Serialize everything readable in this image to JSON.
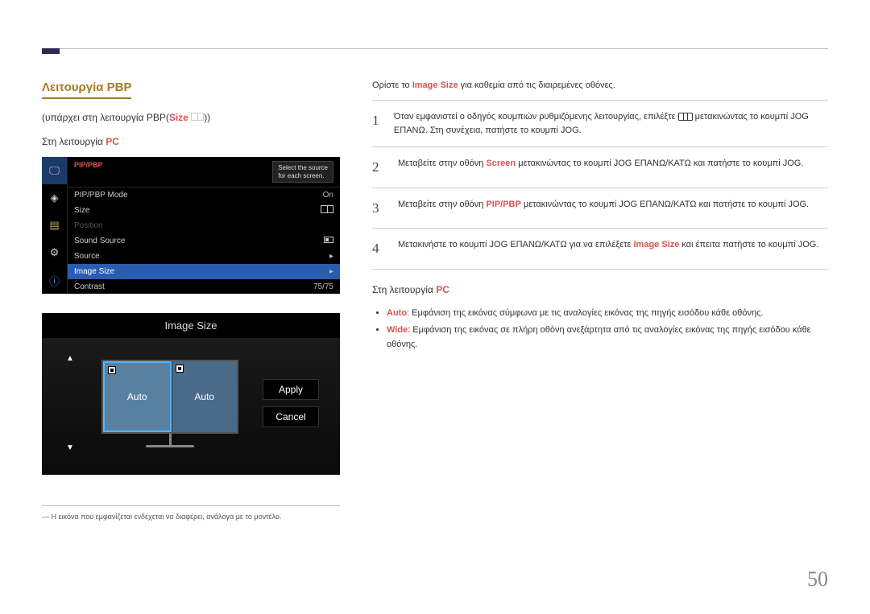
{
  "title": "Λειτουργία PBP",
  "subtitle_prefix": "(υπάρχει στη λειτουργία PBP(",
  "subtitle_accent": "Size",
  "subtitle_suffix": " ",
  "subtitle_close": "))",
  "mode_prefix": "Στη λειτουργία ",
  "mode_accent": "PC",
  "osd": {
    "head": "PIP/PBP",
    "tooltip_line1": "Select the source",
    "tooltip_line2": "for each screen.",
    "rows": [
      {
        "label": "PIP/PBP Mode",
        "value": "On",
        "disabled": false,
        "selected": false,
        "icon": null
      },
      {
        "label": "Size",
        "value": "",
        "disabled": false,
        "selected": false,
        "icon": "split"
      },
      {
        "label": "Position",
        "value": "",
        "disabled": true,
        "selected": false,
        "icon": null
      },
      {
        "label": "Sound Source",
        "value": "",
        "disabled": false,
        "selected": false,
        "icon": "small"
      },
      {
        "label": "Source",
        "value": "▸",
        "disabled": false,
        "selected": false,
        "icon": null
      },
      {
        "label": "Image Size",
        "value": "▸",
        "disabled": false,
        "selected": true,
        "icon": null
      },
      {
        "label": "Contrast",
        "value": "75/75",
        "disabled": false,
        "selected": false,
        "icon": null
      }
    ]
  },
  "size_panel": {
    "title": "Image Size",
    "left": "Auto",
    "right": "Auto",
    "apply": "Apply",
    "cancel": "Cancel"
  },
  "footnote": "― Η εικόνα που εμφανίζεται ενδέχεται να διαφέρει, ανάλογα με το μοντέλο.",
  "intro_prefix": "Ορίστε το ",
  "intro_accent": "Image Size",
  "intro_suffix": " για καθεμία από τις διαιρεμένες οθόνες.",
  "steps": [
    {
      "num": "1",
      "parts": [
        "Όταν εμφανιστεί ο οδηγός κουμπιών ρυθμιζόμενης λειτουργίας, επιλέξτε ",
        "[JOG]",
        " μετακινώντας το κουμπί JOG ΕΠΑΝΩ. Στη συνέχεια, πατήστε το κουμπί JOG."
      ]
    },
    {
      "num": "2",
      "parts": [
        "Μεταβείτε στην οθόνη ",
        "Screen",
        " μετακινώντας το κουμπί JOG ΕΠΑΝΩ/ΚΑΤΩ και πατήστε το κουμπί JOG."
      ]
    },
    {
      "num": "3",
      "parts": [
        "Μεταβείτε στην οθόνη ",
        "PIP/PBP",
        " μετακινώντας το κουμπί JOG ΕΠΑΝΩ/ΚΑΤΩ και πατήστε το κουμπί JOG."
      ]
    },
    {
      "num": "4",
      "parts": [
        "Μετακινήστε το κουμπί JOG ΕΠΑΝΩ/ΚΑΤΩ για να επιλέξετε ",
        "Image Size",
        " και έπειτα πατήστε το κουμπί JOG."
      ]
    }
  ],
  "pc_mode_prefix": "Στη λειτουργία ",
  "pc_mode_accent": "PC",
  "bullets": [
    {
      "accent": "Auto",
      "text": ": Εμφάνιση της εικόνας σύμφωνα με τις αναλογίες εικόνας της πηγής εισόδου κάθε οθόνης."
    },
    {
      "accent": "Wide",
      "text": ": Εμφάνιση της εικόνας σε πλήρη οθόνη ανεξάρτητα από τις αναλογίες εικόνας της πηγής εισόδου κάθε οθόνης."
    }
  ],
  "page_number": "50"
}
